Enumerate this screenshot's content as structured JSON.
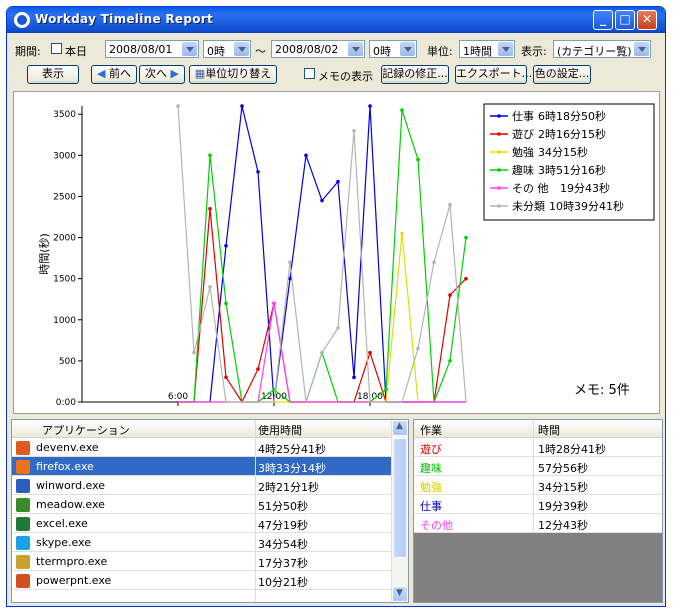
{
  "window": {
    "title": "Workday Timeline Report"
  },
  "toolbar": {
    "period_label": "期間:",
    "today_label": "本日",
    "start_date": "2008/08/01",
    "start_hour": "0時",
    "tilde": "～",
    "end_date": "2008/08/02",
    "end_hour": "0時",
    "unit_label": "単位:",
    "unit_value": "1時間",
    "display_label": "表示:",
    "display_value": "(カテゴリー覧)",
    "show_button": "表示",
    "prev_button": "前へ",
    "next_button": "次へ",
    "unit_switch_button": "単位切り替え",
    "memo_show_label": "メモの表示",
    "edit_record_button": "記録の修正...",
    "export_button": "エクスポート...",
    "color_settings_button": "色の設定..."
  },
  "chart_data": {
    "type": "line",
    "ylabel": "時間(秒)",
    "ylim": [
      0,
      3600
    ],
    "yticks": [
      "0:00",
      "500",
      "1000",
      "1500",
      "2000",
      "2500",
      "3000",
      "3500"
    ],
    "xlim": [
      0,
      24
    ],
    "xticks": [
      "6:00",
      "12:00",
      "18:00"
    ],
    "x": [
      6,
      7,
      8,
      9,
      10,
      11,
      12,
      13,
      14,
      15,
      16,
      17,
      18,
      19,
      20,
      21,
      22,
      23,
      24
    ],
    "memo_text": "メモ: 5件",
    "legend_position": "top-right",
    "series": [
      {
        "name": "仕事",
        "total": "6時18分50秒",
        "color": "#0000e0",
        "values": [
          0,
          0,
          0,
          1900,
          3600,
          2800,
          0,
          1500,
          3000,
          2450,
          2680,
          300,
          3600,
          0,
          0,
          0,
          0,
          0,
          0
        ]
      },
      {
        "name": "遊び",
        "total": "2時16分15秒",
        "color": "#e00000",
        "values": [
          0,
          0,
          2350,
          300,
          0,
          400,
          1200,
          0,
          0,
          0,
          0,
          0,
          600,
          0,
          0,
          0,
          0,
          1300,
          1500
        ]
      },
      {
        "name": "勉強",
        "total": "34分15秒",
        "color": "#e0e000",
        "values": [
          0,
          0,
          0,
          0,
          0,
          0,
          0,
          0,
          0,
          0,
          0,
          0,
          0,
          0,
          2050,
          0,
          0,
          0,
          0
        ]
      },
      {
        "name": "趣味",
        "total": "3時51分16秒",
        "color": "#00d000",
        "values": [
          0,
          0,
          3000,
          1200,
          0,
          0,
          150,
          0,
          0,
          600,
          0,
          0,
          0,
          150,
          3550,
          2950,
          0,
          500,
          2000
        ]
      },
      {
        "name": "その 他",
        "total": "19分43秒",
        "color": "#ff40ff",
        "values": [
          0,
          0,
          0,
          0,
          0,
          0,
          1200,
          0,
          0,
          0,
          0,
          0,
          0,
          0,
          0,
          0,
          0,
          0,
          0
        ]
      },
      {
        "name": "未分類",
        "total": "10時39分41秒",
        "color": "#b4b4b4",
        "values": [
          3600,
          600,
          1400,
          0,
          0,
          0,
          0,
          1700,
          0,
          600,
          900,
          3300,
          0,
          0,
          0,
          650,
          1700,
          2400,
          0
        ]
      }
    ]
  },
  "app_table": {
    "columns": [
      "アプリケーション",
      "使用時間"
    ],
    "rows": [
      {
        "icon": "devenv-icon",
        "name": "devenv.exe",
        "time": "4時25分41秒",
        "color": "#e05a1c"
      },
      {
        "icon": "firefox-icon",
        "name": "firefox.exe",
        "time": "3時33分14秒",
        "color": "#e8741c"
      },
      {
        "icon": "word-icon",
        "name": "winword.exe",
        "time": "2時21分1秒",
        "color": "#2a5fbf"
      },
      {
        "icon": "meadow-icon",
        "name": "meadow.exe",
        "time": "51分50秒",
        "color": "#3a8a2c"
      },
      {
        "icon": "excel-icon",
        "name": "excel.exe",
        "time": "47分19秒",
        "color": "#1f7a3a"
      },
      {
        "icon": "skype-icon",
        "name": "skype.exe",
        "time": "34分54秒",
        "color": "#1aa3e8"
      },
      {
        "icon": "terminal-icon",
        "name": "ttermpro.exe",
        "time": "17分37秒",
        "color": "#c8a030"
      },
      {
        "icon": "powerpoint-icon",
        "name": "powerpnt.exe",
        "time": "10分21秒",
        "color": "#d05020"
      }
    ]
  },
  "category_table": {
    "columns": [
      "作業",
      "時間"
    ],
    "rows": [
      {
        "name": "遊び",
        "time": "1時28分41秒",
        "color": "#e00000"
      },
      {
        "name": "趣味",
        "time": "57分56秒",
        "color": "#00c000"
      },
      {
        "name": "勉強",
        "time": "34分15秒",
        "color": "#d0d000"
      },
      {
        "name": "仕事",
        "time": "19分39秒",
        "color": "#0000c0"
      },
      {
        "name": "その他",
        "time": "12分43秒",
        "color": "#ff40ff"
      }
    ]
  }
}
